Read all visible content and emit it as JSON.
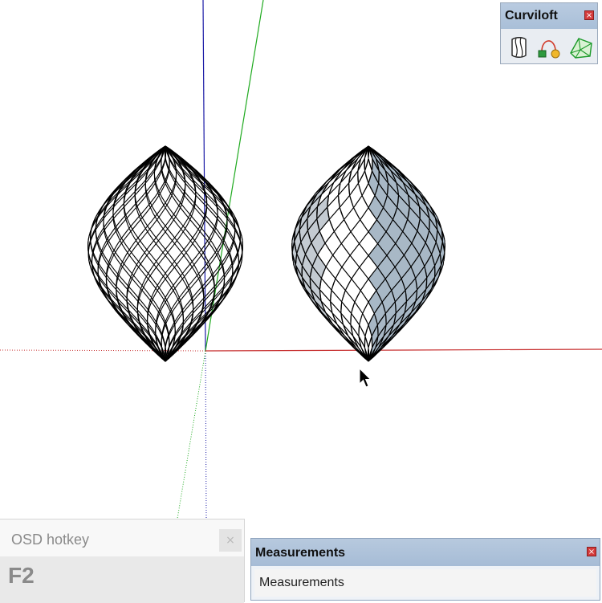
{
  "app": {
    "toolbar": {
      "title": "Curviloft",
      "close_glyph": "×",
      "buttons": [
        {
          "icon": "loft-by-spline-icon"
        },
        {
          "icon": "curve-skinning-icon"
        },
        {
          "icon": "curve-contour-icon"
        }
      ]
    },
    "osd": {
      "title": "OSD hotkey",
      "close_glyph": "×",
      "hotkey": "F2"
    },
    "measurements": {
      "title": "Measurements",
      "close_glyph": "×",
      "label": "Measurements"
    }
  },
  "colors": {
    "axis_red": "#c83232",
    "axis_green": "#1faa1f",
    "axis_blue": "#1a1aa6",
    "wire": "#000000",
    "face_light": "#ffffff",
    "face_blue": "#a8b8c6",
    "face_grey": "#c4cbd2"
  },
  "cursor": {
    "icon": "mouse-pointer-icon"
  }
}
